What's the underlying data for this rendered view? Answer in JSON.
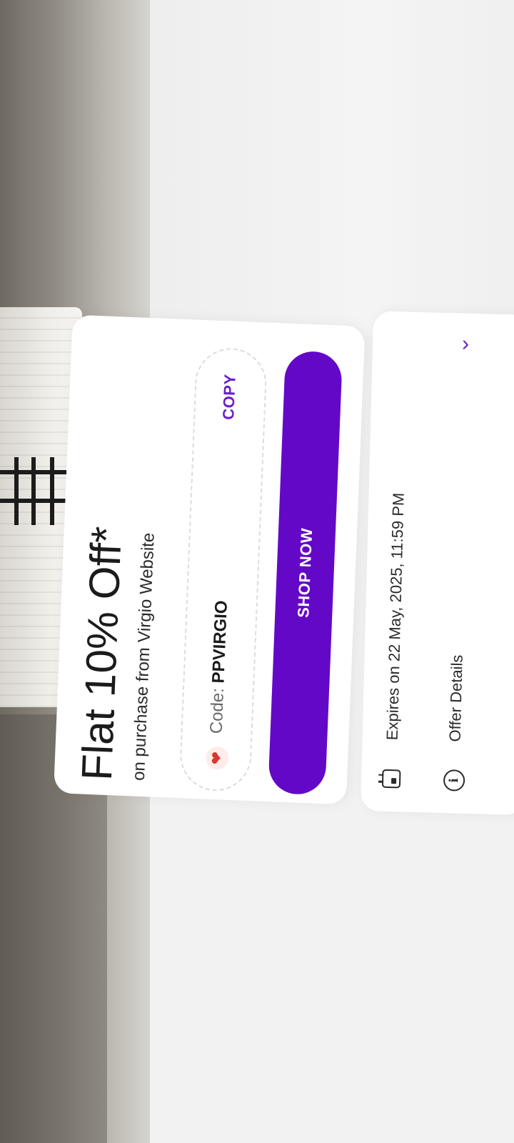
{
  "offer": {
    "title": "Flat 10% Off*",
    "subtitle": "on purchase from Virgio Website",
    "code_label": "Code: ",
    "code_value": "PPVIRGIO",
    "copy_label": "COPY",
    "shop_label": "SHOP NOW",
    "heart_icon": "heart-icon"
  },
  "info": {
    "expiry_text": "Expires on 22 May, 2025, 11:59 PM",
    "details_label": "Offer Details",
    "expiry_icon": "calendar-icon",
    "details_icon": "info-icon",
    "details_chevron": "chevron-right-icon"
  },
  "colors": {
    "accent": "#6408c8",
    "copy_text": "#6c1fc7",
    "heart": "#d7382f",
    "background": "#f2f2f2"
  }
}
